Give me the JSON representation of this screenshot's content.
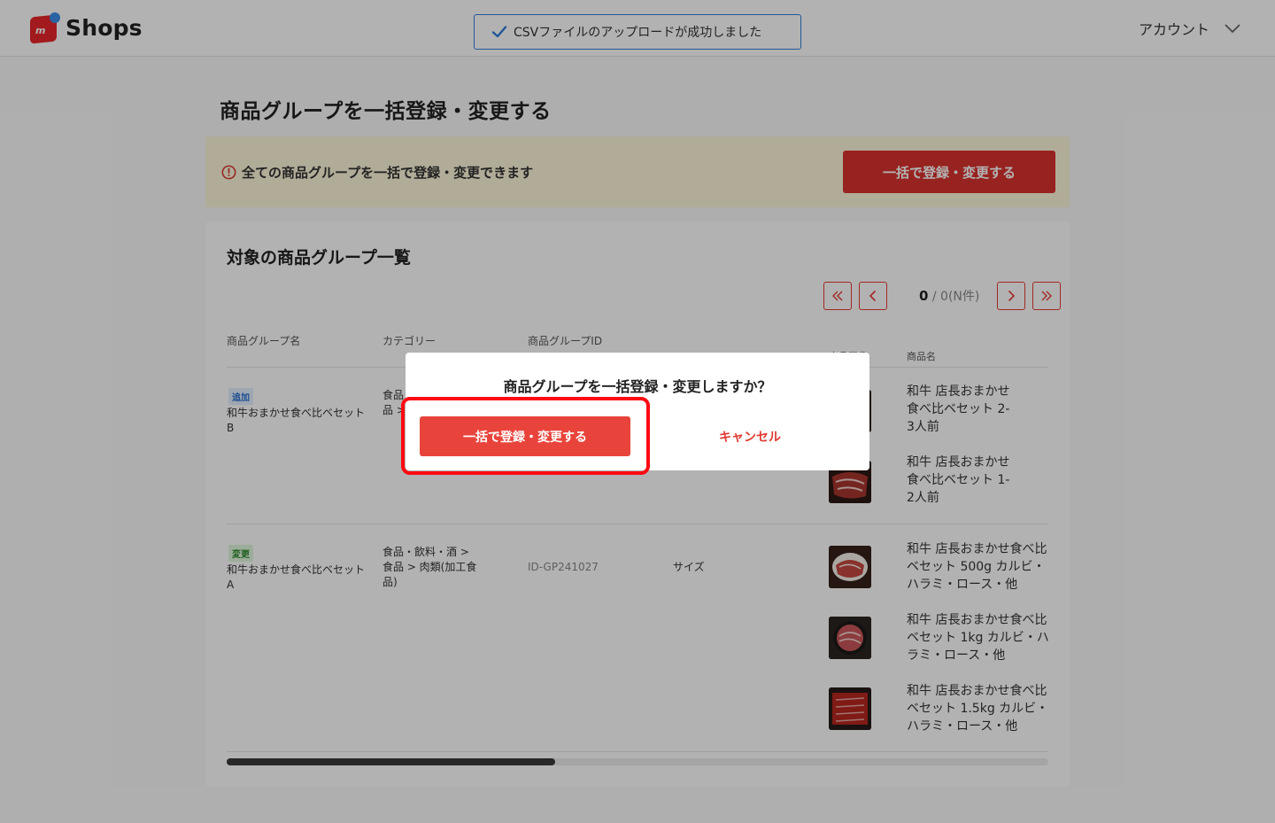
{
  "header": {
    "logo_text": "Shops",
    "toast": "CSVファイルのアップロードが成功しました",
    "account": "アカウント"
  },
  "page": {
    "title": "商品グループを一括登録・変更する"
  },
  "notice": {
    "text": "全ての商品グループを一括で登録・変更できます",
    "button": "一括で登録・変更する"
  },
  "list": {
    "title": "対象の商品グループ一覧",
    "pager": {
      "current": "0",
      "rest": " / 0(N件)"
    },
    "headers": [
      "商品グループ名",
      "カテゴリー",
      "商品グループID",
      "商品画像",
      "商品名"
    ],
    "rows": [
      {
        "badge": "追加",
        "name": "和牛おまかせ食べ比ベセット B",
        "category": "食品・飲料・酒 > 食品 > 肉類(加工食品)",
        "products": [
          "和牛 店長おまかせ食べ比ベセット 2-3人前",
          "和牛 店長おまかせ食べ比ベセット 1-2人前"
        ]
      },
      {
        "badge": "変更",
        "name": "和牛おまかせ食べ比ベセット A",
        "category": "食品・飲料・酒 > 食品 > 肉類(加工食品)",
        "group_id": "ID-GP241027",
        "option": "サイズ",
        "products": [
          "和牛 店長おまかせ食べ比ベセット 500g カルビ・ハラミ・ロース・他",
          "和牛 店長おまかせ食べ比ベセット 1kg カルビ・ハラミ・ロース・他",
          "和牛 店長おまかせ食べ比ベセット 1.5kg カルビ・ハラミ・ロース・他"
        ]
      }
    ],
    "scroll_position": 0.4
  },
  "modal": {
    "title": "商品グループを一括登録・変更しますか？",
    "confirm": "一括で登録・変更する",
    "cancel": "キャンセル"
  },
  "colors": {
    "primary_red": "#d9332e",
    "toast_blue": "#2f7fd8",
    "notice_bg": "#fdf7da",
    "highlight": "#ff0a12"
  }
}
